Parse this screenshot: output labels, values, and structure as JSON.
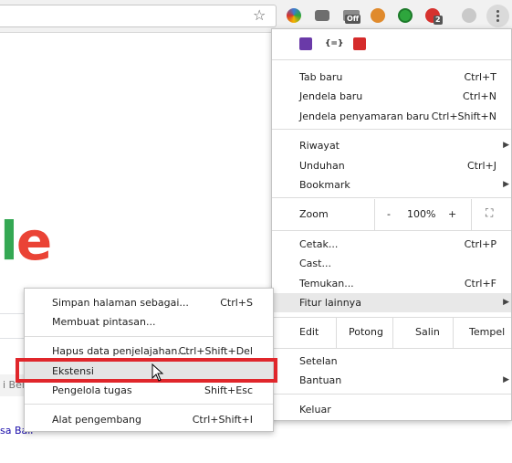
{
  "toolbar": {
    "bookmark_icon": "star-icon",
    "extensions": [
      {
        "name": "colorful-extension-icon",
        "color": "#3b7bd6"
      },
      {
        "name": "camera-icon",
        "color": "#6e6e6e"
      },
      {
        "name": "off-toggle-icon",
        "color": "#4a4a4a",
        "badge": "Off"
      },
      {
        "name": "image-extension-icon",
        "color": "#e08a2c"
      },
      {
        "name": "green-circle-icon",
        "color": "#2ea63d"
      },
      {
        "name": "adblock-icon",
        "color": "#d6322e",
        "badge": "2"
      },
      {
        "name": "profile-icon",
        "color": "#c9c9c9"
      }
    ],
    "menu_icon": "more-vert-icon"
  },
  "page": {
    "logo_fragment_l": "l",
    "logo_fragment_e": "e",
    "button_fragment": "i Ber",
    "link_fragment": "sa Bali"
  },
  "menu": {
    "ext_icons": [
      {
        "name": "purple-extension-icon",
        "color": "#6a3aa8"
      },
      {
        "name": "code-brackets-icon",
        "text": "{=}"
      },
      {
        "name": "red-arrow-extension-icon",
        "color": "#d52b2b"
      }
    ],
    "new_tab": {
      "label": "Tab baru",
      "shortcut": "Ctrl+T"
    },
    "new_window": {
      "label": "Jendela baru",
      "shortcut": "Ctrl+N"
    },
    "incognito": {
      "label": "Jendela penyamaran baru",
      "shortcut": "Ctrl+Shift+N"
    },
    "history": {
      "label": "Riwayat"
    },
    "downloads": {
      "label": "Unduhan",
      "shortcut": "Ctrl+J"
    },
    "bookmarks": {
      "label": "Bookmark"
    },
    "zoom": {
      "label": "Zoom",
      "minus": "-",
      "value": "100%",
      "plus": "+"
    },
    "print": {
      "label": "Cetak...",
      "shortcut": "Ctrl+P"
    },
    "cast": {
      "label": "Cast..."
    },
    "find": {
      "label": "Temukan...",
      "shortcut": "Ctrl+F"
    },
    "more_tools": {
      "label": "Fitur lainnya"
    },
    "edit": {
      "label": "Edit",
      "cut": "Potong",
      "copy": "Salin",
      "paste": "Tempel"
    },
    "settings": {
      "label": "Setelan"
    },
    "help": {
      "label": "Bantuan"
    },
    "exit": {
      "label": "Keluar"
    }
  },
  "submenu": {
    "save_page": {
      "label": "Simpan halaman sebagai...",
      "shortcut": "Ctrl+S"
    },
    "create_shortcut": {
      "label": "Membuat pintasan..."
    },
    "clear_data": {
      "label": "Hapus data penjelajahan...",
      "shortcut": "Ctrl+Shift+Del"
    },
    "extensions": {
      "label": "Ekstensi"
    },
    "task_manager": {
      "label": "Pengelola tugas",
      "shortcut": "Shift+Esc"
    },
    "dev_tools": {
      "label": "Alat pengembang",
      "shortcut": "Ctrl+Shift+I"
    }
  },
  "annotation": {
    "highlight_color": "#e0262b"
  }
}
